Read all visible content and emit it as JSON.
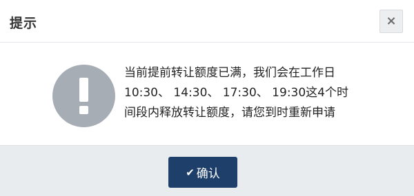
{
  "dialog": {
    "title": "提示",
    "close_glyph": "×",
    "icon": "exclamation-circle-icon",
    "message_lines": [
      "当前提前转让额度已满，我们会在工作日",
      "10:30、 14:30、 17:30、 19:30这4个时",
      "间段内释放转让额度，请您到时重新申请"
    ],
    "confirm": {
      "check_glyph": "✔",
      "label": "确认"
    }
  },
  "colors": {
    "icon_circle": "#a7adb5",
    "button_bg": "#1e3f6a",
    "footer_bg": "#e9ecee"
  }
}
